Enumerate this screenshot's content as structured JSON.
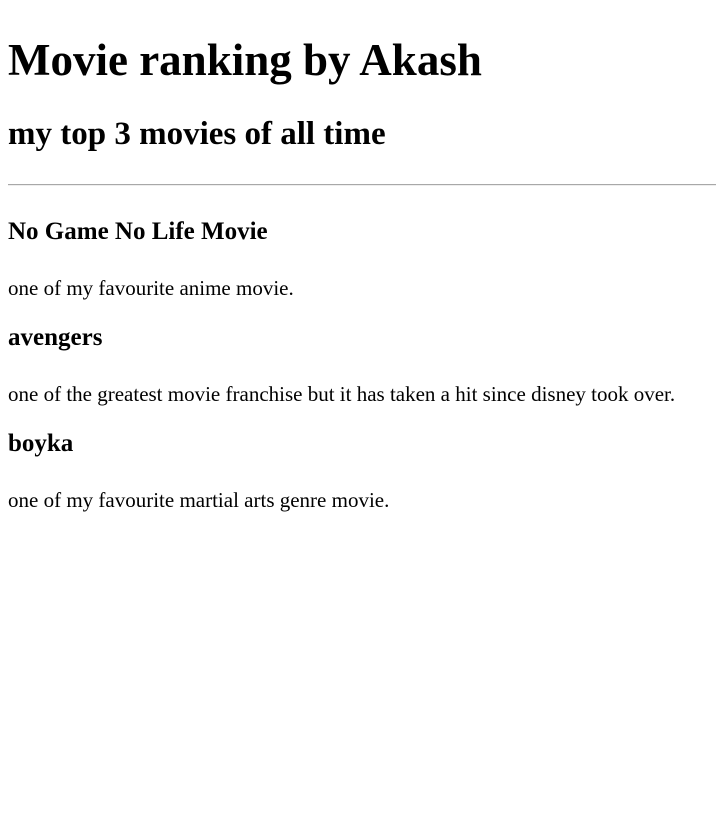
{
  "header": {
    "title": "Movie ranking by Akash",
    "subtitle": "my top 3 movies of all time"
  },
  "movies": [
    {
      "title": "No Game No Life Movie",
      "description": "one of my favourite anime movie."
    },
    {
      "title": "avengers",
      "description": "one of the greatest movie franchise but it has taken a hit since disney took over."
    },
    {
      "title": "boyka",
      "description": "one of my favourite martial arts genre movie."
    }
  ]
}
